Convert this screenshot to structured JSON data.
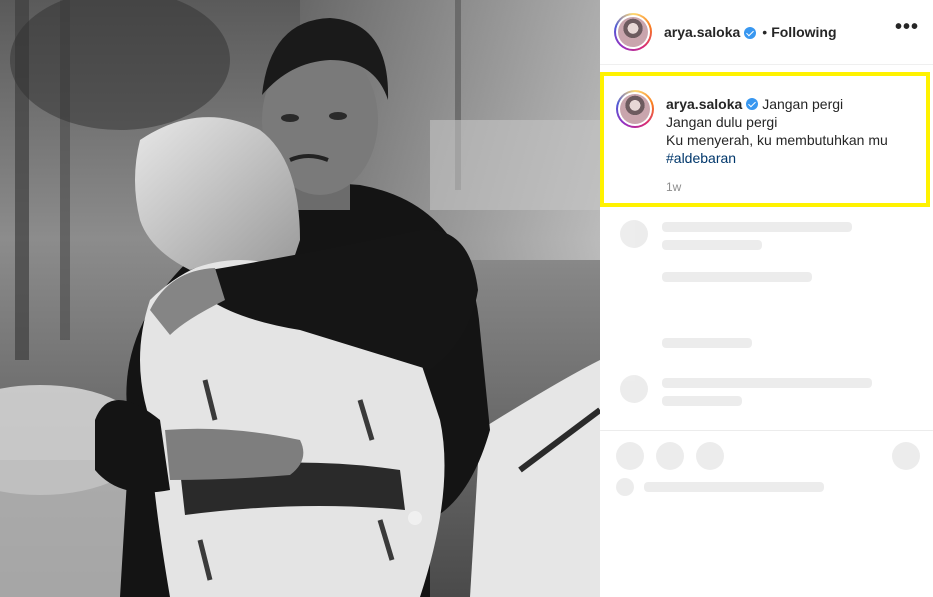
{
  "post": {
    "username": "arya.saloka",
    "following_label": "Following",
    "dot": "•",
    "more_label": "•••",
    "caption": {
      "username": "arya.saloka",
      "line1": "Jangan pergi",
      "line2": "Jangan dulu pergi",
      "line3": "Ku menyerah, ku membutuhkan mu",
      "hashtag": "#aldebaran"
    },
    "age": "1w"
  },
  "colors": {
    "highlight_border": "#fff200",
    "verified": "#3897f0",
    "hashtag": "#00376b",
    "meta_gray": "#8e8e8e"
  },
  "icons": [
    "verified-badge-icon",
    "more-options-icon"
  ]
}
